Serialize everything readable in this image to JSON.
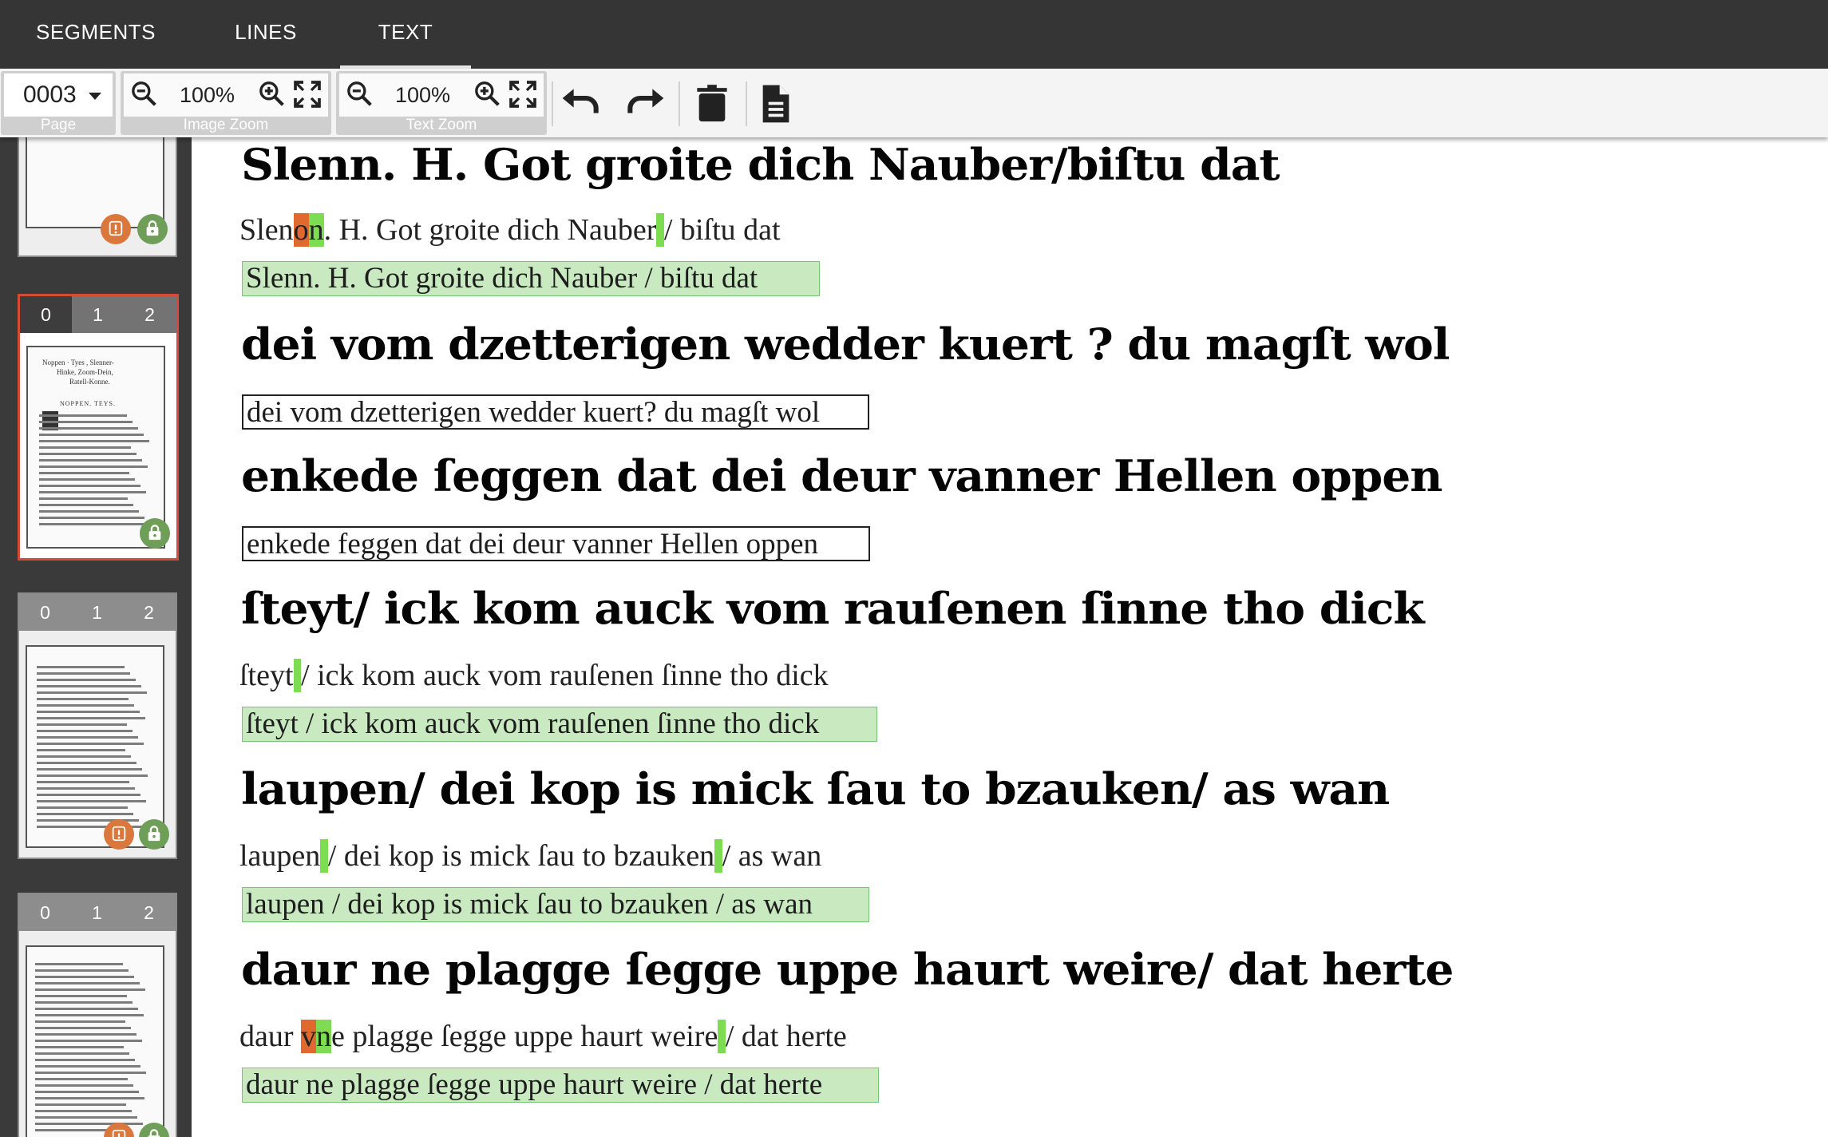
{
  "nav": {
    "tabs": [
      "SEGMENTS",
      "LINES",
      "TEXT"
    ],
    "active": "TEXT"
  },
  "toolbar": {
    "page": {
      "value": "0003",
      "label": "Page"
    },
    "image_zoom": {
      "value": "100%",
      "label": "Image Zoom"
    },
    "text_zoom": {
      "value": "100%",
      "label": "Text Zoom"
    },
    "icons": [
      "zoom-out-icon",
      "zoom-in-icon",
      "fullscreen-icon",
      "undo-icon",
      "redo-icon",
      "trash-icon",
      "document-icon"
    ]
  },
  "sidebar": {
    "selected_thumbnail": 1,
    "thumbnails": [
      {
        "segments": [
          "0",
          "1",
          "2"
        ],
        "mini_text": []
      },
      {
        "segments": [
          "0",
          "1",
          "2"
        ],
        "active_segment": "0",
        "mini_text": [
          "Noppen · Tyes ,   Slenner-",
          "Hinke, Zoom-Dein,",
          "Ratell-Konne.",
          "NOPPEN. TEYS."
        ]
      },
      {
        "segments": [
          "0",
          "1",
          "2"
        ],
        "mini_text": []
      },
      {
        "segments": [
          "0",
          "1",
          "2"
        ],
        "mini_text": []
      }
    ],
    "badge_colors": {
      "warning": "#d9773d",
      "locked": "#6e9e57"
    }
  },
  "lines": [
    {
      "scan": "Slenn.  H.  Got groite dich Nauber/biſtu dat",
      "ocr": [
        {
          "t": "Slen"
        },
        {
          "t": "o",
          "h": "o"
        },
        {
          "t": "n",
          "h": "g"
        },
        {
          "t": ". H. Got groite dich Nauber"
        },
        {
          "t": " ",
          "h": "g"
        },
        {
          "t": "/ biſtu dat"
        }
      ],
      "gt": "Slenn. H. Got groite dich Nauber / biſtu dat",
      "status": "ok"
    },
    {
      "scan": "dei vom dzetterigen wedder kuert ? du magſt wol",
      "ocr": [],
      "gt": "dei vom dzetterigen wedder kuert? du magſt wol",
      "status": "todo"
    },
    {
      "scan": "enkede ſeggen dat dei  deur vanner Hellen oppen",
      "ocr": [],
      "gt": "enkede feggen dat dei deur vanner Hellen oppen",
      "status": "todo"
    },
    {
      "scan": "ſteyt/  ick kom auck vom rauſenen ſinne tho dick",
      "ocr": [
        {
          "t": "ſteyt"
        },
        {
          "t": " ",
          "h": "g"
        },
        {
          "t": "/ ick kom auck vom rauſenen ſinne tho dick"
        }
      ],
      "gt": "ſteyt / ick kom auck vom rauſenen ſinne tho dick",
      "status": "ok"
    },
    {
      "scan": "laupen/  dei kop is mick ſau to bzauken/  as wan",
      "ocr": [
        {
          "t": "laupen"
        },
        {
          "t": " ",
          "h": "g"
        },
        {
          "t": "/ dei kop is mick ſau to bzauken"
        },
        {
          "t": " ",
          "h": "g"
        },
        {
          "t": "/ as wan"
        }
      ],
      "gt": "laupen / dei kop is mick ſau to bzauken / as wan",
      "status": "ok"
    },
    {
      "scan": "daur ne plagge ſegge uppe haurt weire/ dat herte",
      "ocr": [
        {
          "t": "daur "
        },
        {
          "t": "v",
          "h": "o"
        },
        {
          "t": "n",
          "h": "g"
        },
        {
          "t": "e plagge ſegge uppe haurt weire"
        },
        {
          "t": " ",
          "h": "g"
        },
        {
          "t": "/ dat herte"
        }
      ],
      "gt": "daur ne plagge ſegge uppe haurt weire / dat herte",
      "status": "ok"
    }
  ]
}
